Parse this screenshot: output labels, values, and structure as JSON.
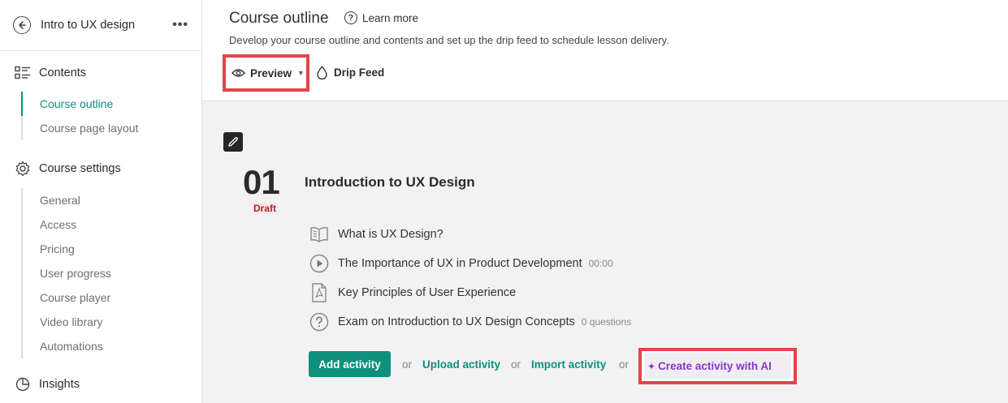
{
  "sidebar": {
    "course_title": "Intro to UX design",
    "more_label": "•••",
    "contents_label": "Contents",
    "contents_items": [
      {
        "label": "Course outline",
        "active": true
      },
      {
        "label": "Course page layout",
        "active": false
      }
    ],
    "settings_label": "Course settings",
    "settings_items": [
      {
        "label": "General"
      },
      {
        "label": "Access"
      },
      {
        "label": "Pricing"
      },
      {
        "label": "User progress"
      },
      {
        "label": "Course player"
      },
      {
        "label": "Video library"
      },
      {
        "label": "Automations"
      }
    ],
    "insights_label": "Insights"
  },
  "header": {
    "title": "Course outline",
    "learn_more": "Learn more",
    "description": "Develop your course outline and contents and set up the drip feed to schedule lesson delivery.",
    "preview_label": "Preview",
    "drip_feed_label": "Drip Feed"
  },
  "module": {
    "number": "01",
    "status": "Draft",
    "title": "Introduction to UX Design",
    "activities": [
      {
        "icon": "book-icon",
        "label": "What is UX Design?",
        "meta": ""
      },
      {
        "icon": "play-icon",
        "label": "The Importance of UX in Product Development",
        "meta": "00:00"
      },
      {
        "icon": "pdf-icon",
        "label": "Key Principles of User Experience",
        "meta": ""
      },
      {
        "icon": "question-icon",
        "label": "Exam on Introduction to UX Design Concepts",
        "meta": "0 questions"
      }
    ],
    "actions": {
      "add_activity": "Add activity",
      "or": "or",
      "upload_activity": "Upload activity",
      "import_activity": "Import activity",
      "create_with_ai": "Create activity with AI"
    }
  },
  "colors": {
    "accent": "#0f8f7e",
    "highlight_border": "#e0454a",
    "ai_purple": "#8a35c9",
    "draft_red": "#b3262b"
  }
}
